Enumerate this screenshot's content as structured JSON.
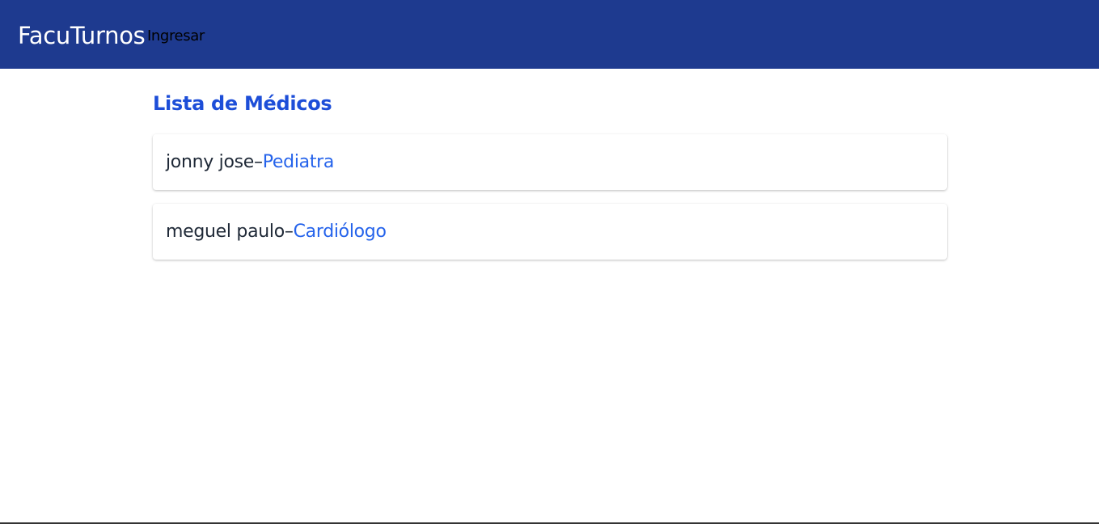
{
  "header": {
    "brand": "FacuTurnos",
    "nav_link": "Ingresar",
    "background_color": "#1e3a8f"
  },
  "main": {
    "title": "Lista de Médicos",
    "separator": " – ",
    "doctors": [
      {
        "name": "jonny jose",
        "specialty": "Pediatra"
      },
      {
        "name": "meguel paulo",
        "specialty": "Cardiólogo"
      }
    ]
  },
  "colors": {
    "accent": "#1d4ed8",
    "specialty": "#2563eb",
    "text": "#1f2937"
  }
}
